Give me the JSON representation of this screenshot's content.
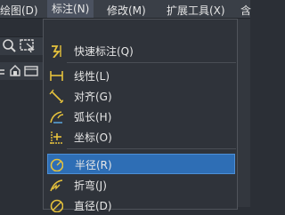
{
  "menubar": {
    "items": [
      {
        "label": "绘图(D)"
      },
      {
        "label": "标注(N)"
      },
      {
        "label": "修改(M)"
      },
      {
        "label": "扩展工具(X)"
      },
      {
        "label": "含"
      }
    ]
  },
  "dimension_menu": {
    "items": [
      {
        "label": "快速标注(Q)",
        "icon": "quick-dimension-icon"
      },
      {
        "label": "线性(L)",
        "icon": "linear-dimension-icon"
      },
      {
        "label": "对齐(G)",
        "icon": "aligned-dimension-icon"
      },
      {
        "label": "弧长(H)",
        "icon": "arc-length-icon"
      },
      {
        "label": "坐标(O)",
        "icon": "ordinate-dimension-icon"
      },
      {
        "label": "半径(R)",
        "icon": "radius-dimension-icon"
      },
      {
        "label": "折弯(J)",
        "icon": "jogged-dimension-icon"
      },
      {
        "label": "直径(D)",
        "icon": "diameter-dimension-icon"
      }
    ]
  },
  "colors": {
    "accent": "#2e6eb5",
    "icon_yellow": "#e6c23c",
    "icon_blue": "#5fb0ec"
  }
}
